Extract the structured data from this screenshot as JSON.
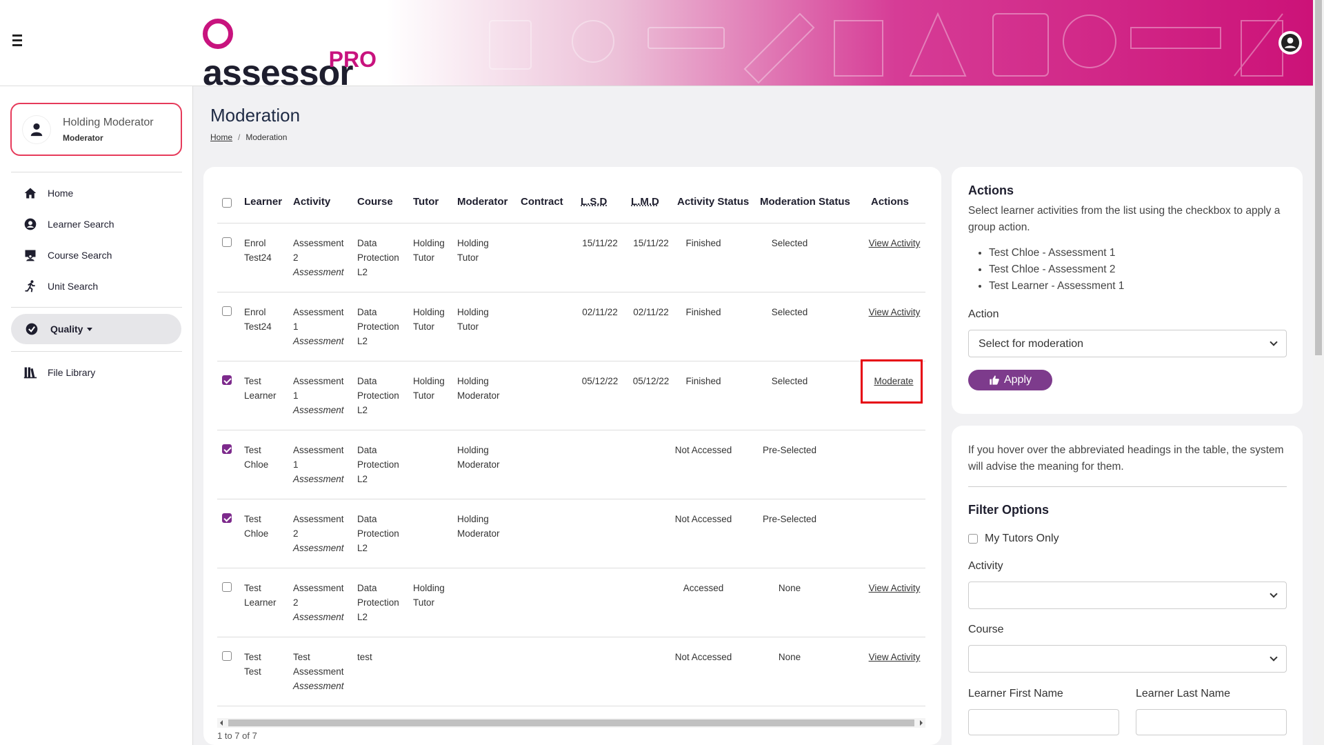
{
  "header": {
    "logo_main": "assessor",
    "logo_pro": "PRO"
  },
  "profile": {
    "name": "Holding Moderator",
    "role": "Moderator"
  },
  "nav": {
    "home": "Home",
    "learner_search": "Learner Search",
    "course_search": "Course Search",
    "unit_search": "Unit Search",
    "quality": "Quality",
    "file_library": "File Library"
  },
  "page": {
    "title": "Moderation",
    "breadcrumb_home": "Home",
    "breadcrumb_current": "Moderation"
  },
  "table": {
    "headers": {
      "learner": "Learner",
      "activity": "Activity",
      "course": "Course",
      "tutor": "Tutor",
      "moderator": "Moderator",
      "contract": "Contract",
      "lsd": "L.S.D",
      "lmd": "L.M.D",
      "activity_status": "Activity Status",
      "moderation_status": "Moderation Status",
      "actions": "Actions"
    },
    "rows": [
      {
        "checked": false,
        "learner": [
          "Enrol",
          "Test24"
        ],
        "activity": [
          "Assessment",
          "2"
        ],
        "activity_type": "Assessment",
        "course": [
          "Data",
          "Protection",
          "L2"
        ],
        "tutor": [
          "Holding",
          "Tutor"
        ],
        "moderator": [
          "Holding",
          "Tutor"
        ],
        "lsd": "15/11/22",
        "lmd": "15/11/22",
        "activity_status": "Finished",
        "moderation_status": "Selected",
        "action": "View Activity"
      },
      {
        "checked": false,
        "learner": [
          "Enrol",
          "Test24"
        ],
        "activity": [
          "Assessment",
          "1"
        ],
        "activity_type": "Assessment",
        "course": [
          "Data",
          "Protection",
          "L2"
        ],
        "tutor": [
          "Holding",
          "Tutor"
        ],
        "moderator": [
          "Holding",
          "Tutor"
        ],
        "lsd": "02/11/22",
        "lmd": "02/11/22",
        "activity_status": "Finished",
        "moderation_status": "Selected",
        "action": "View Activity"
      },
      {
        "checked": true,
        "learner": [
          "Test",
          "Learner"
        ],
        "activity": [
          "Assessment",
          "1"
        ],
        "activity_type": "Assessment",
        "course": [
          "Data",
          "Protection",
          "L2"
        ],
        "tutor": [
          "Holding",
          "Tutor"
        ],
        "moderator": [
          "Holding",
          "Moderator"
        ],
        "lsd": "05/12/22",
        "lmd": "05/12/22",
        "activity_status": "Finished",
        "moderation_status": "Selected",
        "action": "Moderate"
      },
      {
        "checked": true,
        "learner": [
          "Test",
          "Chloe"
        ],
        "activity": [
          "Assessment",
          "1"
        ],
        "activity_type": "Assessment",
        "course": [
          "Data",
          "Protection",
          "L2"
        ],
        "tutor": [
          "",
          ""
        ],
        "moderator": [
          "Holding",
          "Moderator"
        ],
        "lsd": "",
        "lmd": "",
        "activity_status": "Not Accessed",
        "moderation_status": "Pre-Selected",
        "action": ""
      },
      {
        "checked": true,
        "learner": [
          "Test",
          "Chloe"
        ],
        "activity": [
          "Assessment",
          "2"
        ],
        "activity_type": "Assessment",
        "course": [
          "Data",
          "Protection",
          "L2"
        ],
        "tutor": [
          "",
          ""
        ],
        "moderator": [
          "Holding",
          "Moderator"
        ],
        "lsd": "",
        "lmd": "",
        "activity_status": "Not Accessed",
        "moderation_status": "Pre-Selected",
        "action": ""
      },
      {
        "checked": false,
        "learner": [
          "Test",
          "Learner"
        ],
        "activity": [
          "Assessment",
          "2"
        ],
        "activity_type": "Assessment",
        "course": [
          "Data",
          "Protection",
          "L2"
        ],
        "tutor": [
          "Holding",
          "Tutor"
        ],
        "moderator": [
          "",
          ""
        ],
        "lsd": "",
        "lmd": "",
        "activity_status": "Accessed",
        "moderation_status": "None",
        "action": "View Activity"
      },
      {
        "checked": false,
        "learner": [
          "Test",
          "Test"
        ],
        "activity": [
          "Test",
          "Assessment"
        ],
        "activity_type": "Assessment",
        "course": [
          "test",
          "",
          ""
        ],
        "tutor": [
          "",
          ""
        ],
        "moderator": [
          "",
          ""
        ],
        "lsd": "",
        "lmd": "",
        "activity_status": "Not Accessed",
        "moderation_status": "None",
        "action": "View Activity"
      }
    ],
    "pager": "1 to 7 of 7"
  },
  "actions_panel": {
    "title": "Actions",
    "description": "Select learner activities from the list using the checkbox to apply a group action.",
    "selected": [
      "Test Chloe - Assessment 1",
      "Test Chloe - Assessment 2",
      "Test Learner - Assessment 1"
    ],
    "action_label": "Action",
    "action_value": "Select for moderation",
    "apply_label": "Apply"
  },
  "filter_panel": {
    "hint": "If you hover over the abbreviated headings in the table, the system will advise the meaning for them.",
    "title": "Filter Options",
    "my_tutors_only": "My Tutors Only",
    "activity_label": "Activity",
    "course_label": "Course",
    "first_name_label": "Learner First Name",
    "last_name_label": "Learner Last Name"
  },
  "colors": {
    "brand_magenta": "#c8137e",
    "accent_purple": "#7d3b8c",
    "highlight_red": "#e6000f"
  }
}
